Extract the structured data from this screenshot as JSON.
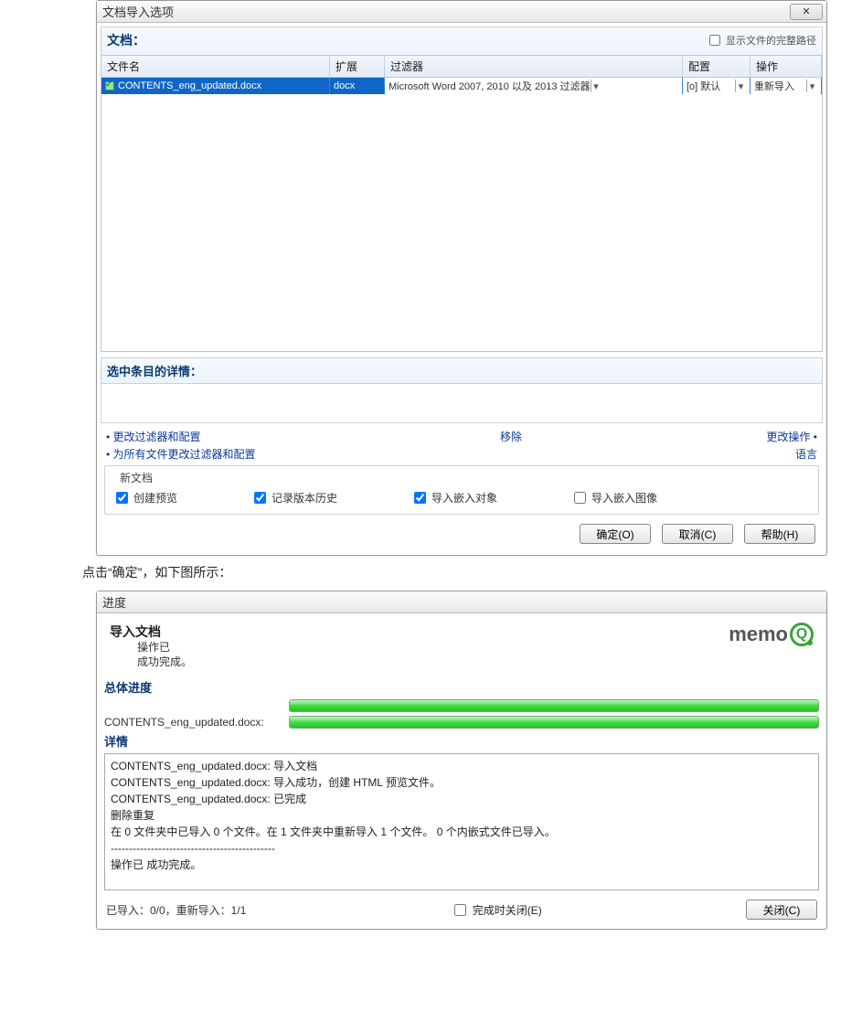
{
  "dialog1": {
    "title": "文档导入选项",
    "sectionLabel": "文档：",
    "showFullPathLabel": "显示文件的完整路径",
    "columns": {
      "name": "文件名",
      "ext": "扩展",
      "filter": "过滤器",
      "config": "配置",
      "op": "操作"
    },
    "row": {
      "filename": "CONTENTS_eng_updated.docx",
      "ext": "docx",
      "filter": "Microsoft Word 2007, 2010 以及 2013 过滤器",
      "config": "[o] 默认",
      "op": "重新导入"
    },
    "detailLabel": "选中条目的详情：",
    "links": {
      "changeFilter": "更改过滤器和配置",
      "changeAll": "为所有文件更改过滤器和配置",
      "remove": "移除",
      "changeOp": "更改操作",
      "language": "语言"
    },
    "groupLabel": "新文档",
    "checkboxes": {
      "createPreview": "创建预览",
      "recordHistory": "记录版本历史",
      "importEmbedObj": "导入嵌入对象",
      "importEmbedImg": "导入嵌入图像"
    },
    "buttons": {
      "ok": "确定(O)",
      "cancel": "取消(C)",
      "help": "帮助(H)"
    }
  },
  "caption": "点击“确定”，如下图所示：",
  "dialog2": {
    "title": "进度",
    "opTitle": "导入文档",
    "opSubLine1": "操作已",
    "opSubLine2": "成功完成。",
    "brand": "memo",
    "overallLabel": "总体进度",
    "fileProgressLabel": "CONTENTS_eng_updated.docx:",
    "detailsLabel": "详情",
    "detailLines": [
      "CONTENTS_eng_updated.docx:  导入文档",
      "CONTENTS_eng_updated.docx:  导入成功，创建 HTML 预览文件。",
      "CONTENTS_eng_updated.docx:  已完成",
      "删除重复",
      "在 0 文件夹中已导入 0 个文件。在 1 文件夹中重新导入 1 个文件。 0 个内嵌式文件已导入。",
      "---------------------------------------------",
      "操作已 成功完成。"
    ],
    "footer": {
      "summary": "已导入：0/0，重新导入：1/1",
      "closeOnFinish": "完成时关闭(E)",
      "close": "关闭(C)"
    }
  }
}
